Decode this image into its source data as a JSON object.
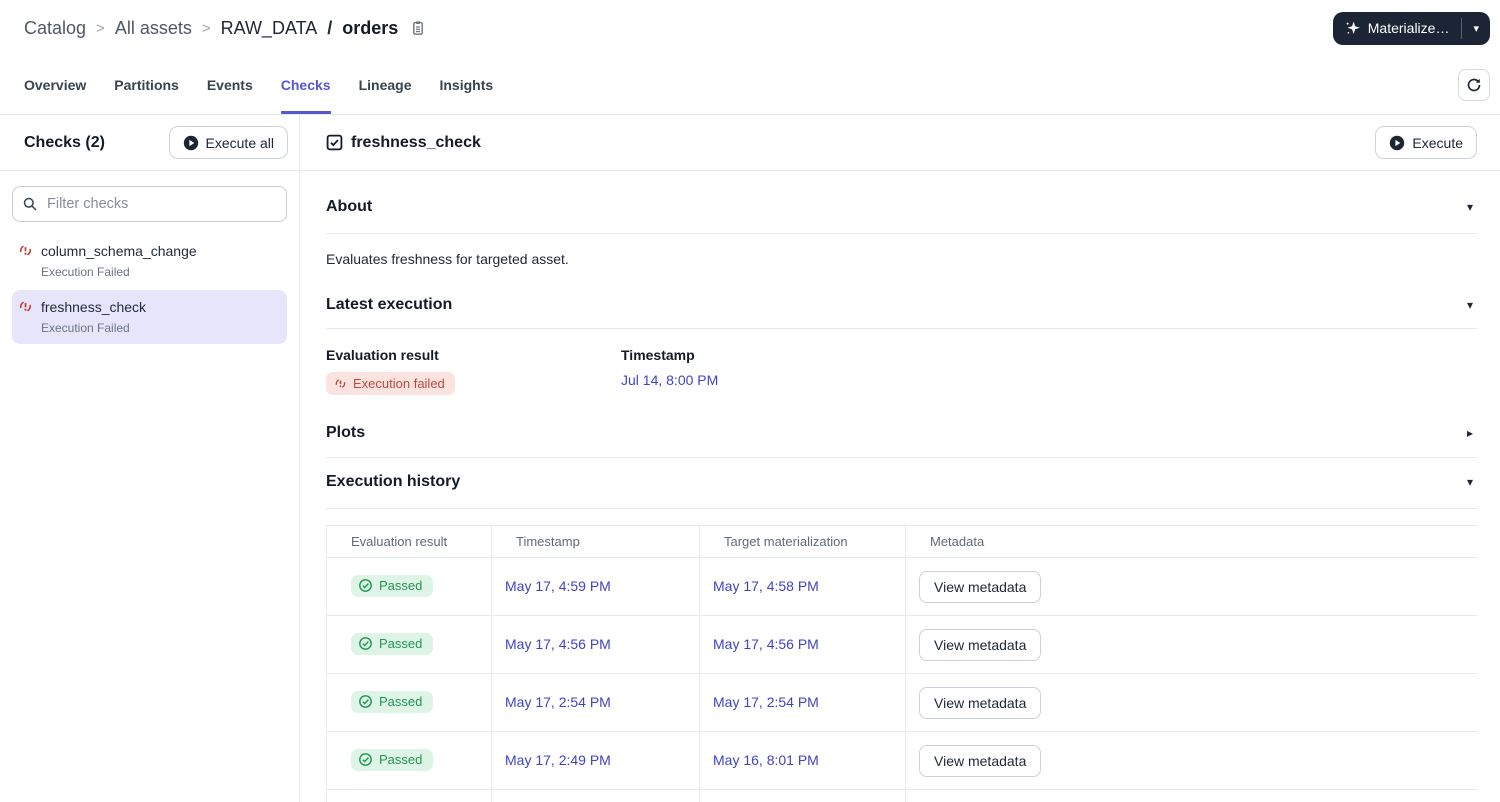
{
  "breadcrumb": {
    "items": [
      "Catalog",
      "All assets"
    ],
    "separator": ">",
    "asset_group": "RAW_DATA",
    "asset_separator": "/",
    "asset_name": "orders"
  },
  "header": {
    "materialize_label": "Materialize…"
  },
  "tabs": [
    {
      "label": "Overview",
      "active": false
    },
    {
      "label": "Partitions",
      "active": false
    },
    {
      "label": "Events",
      "active": false
    },
    {
      "label": "Checks",
      "active": true
    },
    {
      "label": "Lineage",
      "active": false
    },
    {
      "label": "Insights",
      "active": false
    }
  ],
  "sidebar": {
    "title": "Checks (2)",
    "execute_all_label": "Execute all",
    "filter_placeholder": "Filter checks",
    "checks": [
      {
        "name": "column_schema_change",
        "status": "Execution Failed",
        "selected": false
      },
      {
        "name": "freshness_check",
        "status": "Execution Failed",
        "selected": true
      }
    ]
  },
  "main": {
    "title": "freshness_check",
    "execute_label": "Execute",
    "about": {
      "title": "About",
      "body": "Evaluates freshness for targeted asset."
    },
    "latest": {
      "title": "Latest execution",
      "result_label": "Evaluation result",
      "result_value": "Execution failed",
      "timestamp_label": "Timestamp",
      "timestamp_value": "Jul 14, 8:00 PM"
    },
    "plots": {
      "title": "Plots"
    },
    "history": {
      "title": "Execution history",
      "columns": [
        "Evaluation result",
        "Timestamp",
        "Target materialization",
        "Metadata"
      ],
      "rows": [
        {
          "result": "Passed",
          "timestamp": "May 17, 4:59 PM",
          "target": "May 17, 4:58 PM",
          "action": "View metadata"
        },
        {
          "result": "Passed",
          "timestamp": "May 17, 4:56 PM",
          "target": "May 17, 4:56 PM",
          "action": "View metadata"
        },
        {
          "result": "Passed",
          "timestamp": "May 17, 2:54 PM",
          "target": "May 17, 2:54 PM",
          "action": "View metadata"
        },
        {
          "result": "Passed",
          "timestamp": "May 17, 2:49 PM",
          "target": "May 16, 8:01 PM",
          "action": "View metadata"
        }
      ]
    }
  },
  "icons": {
    "chevron_down": "▾",
    "chevron_right": "▸",
    "caret_down": "▾"
  },
  "colors": {
    "accent_purple": "#5857D2",
    "link": "#4142C6",
    "error": "#BA4A3F",
    "error_bg": "#FBE3E0",
    "success": "#219653",
    "success_bg": "#DEF4E6",
    "dark_button": "#1C2536"
  }
}
